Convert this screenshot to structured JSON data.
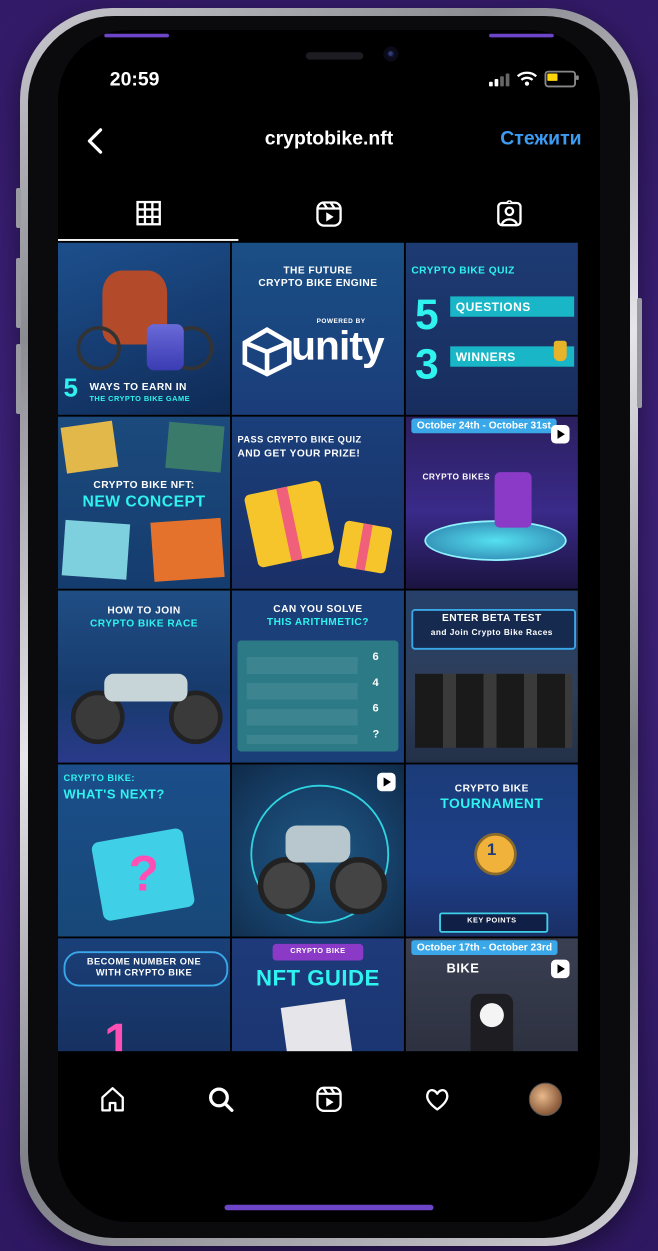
{
  "status_bar": {
    "time": "20:59"
  },
  "header": {
    "username": "cryptobike.nft",
    "follow_label": "Стежити"
  },
  "tabs": [
    {
      "name": "grid",
      "active": true
    },
    {
      "name": "reels",
      "active": false
    },
    {
      "name": "tagged",
      "active": false
    }
  ],
  "posts": [
    {
      "lines": [
        "5",
        "WAYS TO EARN IN",
        "THE CRYPTO BIKE GAME"
      ]
    },
    {
      "lines": [
        "THE FUTURE",
        "CRYPTO BIKE ENGINE",
        "POWERED BY",
        "unity"
      ]
    },
    {
      "lines": [
        "CRYPTO BIKE QUIZ",
        "5",
        "QUESTIONS",
        "3",
        "WINNERS"
      ]
    },
    {
      "lines": [
        "CRYPTO BIKE NFT:",
        "NEW CONCEPT"
      ]
    },
    {
      "lines": [
        "PASS CRYPTO BIKE QUIZ",
        "AND GET YOUR PRIZE!"
      ]
    },
    {
      "lines": [
        "October 24th - October 31st",
        "CRYPTO BIKES"
      ]
    },
    {
      "lines": [
        "HOW TO JOIN",
        "CRYPTO BIKE RACE"
      ]
    },
    {
      "lines": [
        "CAN YOU SOLVE",
        "THIS ARITHMETIC?",
        "6",
        "4",
        "6",
        "?"
      ]
    },
    {
      "lines": [
        "ENTER BETA TEST",
        "and Join Crypto Bike Races"
      ]
    },
    {
      "lines": [
        "CRYPTO BIKE:",
        "WHAT'S NEXT?",
        "?"
      ]
    },
    {
      "lines": []
    },
    {
      "lines": [
        "CRYPTO BIKE",
        "TOURNAMENT",
        "1",
        "KEY POINTS"
      ]
    },
    {
      "lines": [
        "BECOME NUMBER ONE",
        "WITH CRYPTO BIKE",
        "1"
      ]
    },
    {
      "lines": [
        "CRYPTO BIKE",
        "NFT GUIDE"
      ]
    },
    {
      "lines": [
        "October 17th - October 23rd",
        "BIKE"
      ]
    }
  ],
  "colors": {
    "accent_cyan": "#2ff3ee",
    "accent_pink": "#ff4fb5",
    "follow_blue": "#3d9bf2",
    "background_purple": "#3a1f74"
  },
  "bottom_nav": [
    "home-icon",
    "search-icon",
    "reels-icon",
    "heart-icon",
    "profile-avatar"
  ]
}
